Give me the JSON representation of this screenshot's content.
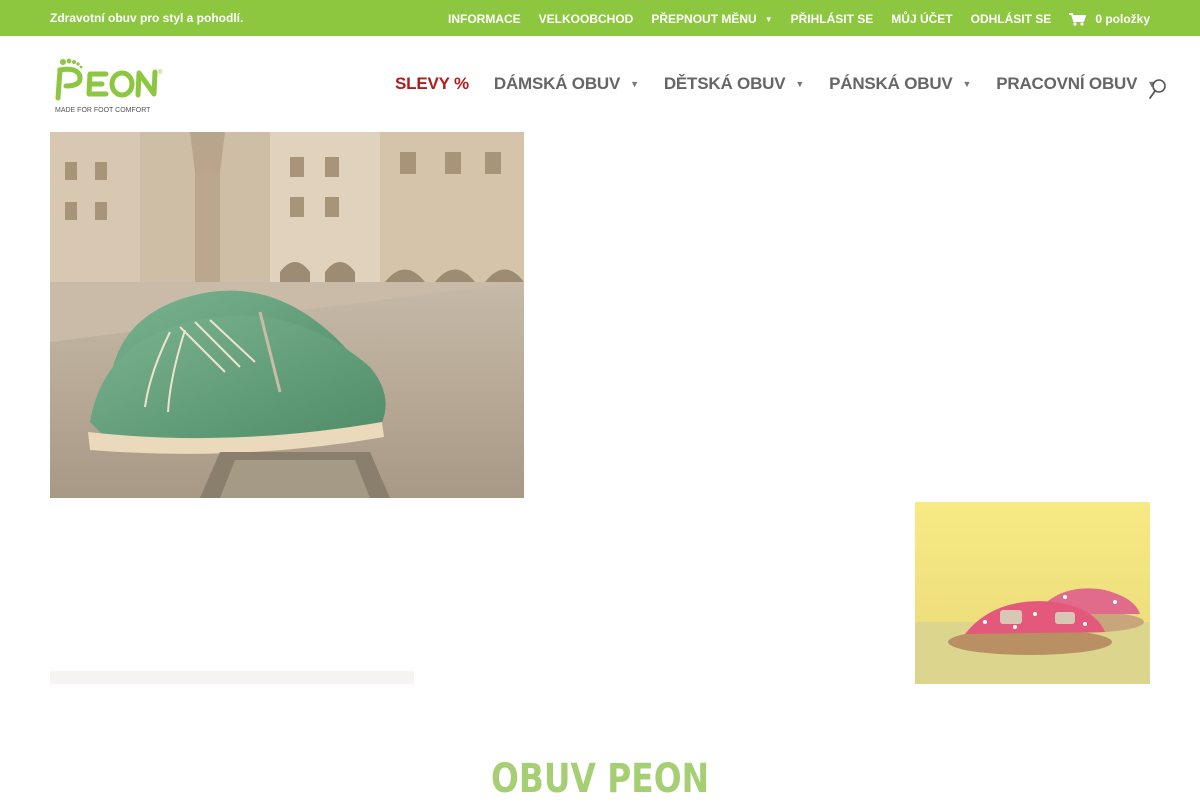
{
  "topbar": {
    "tagline": "Zdravotní obuv pro styl a pohodlí.",
    "links": [
      {
        "label": "INFORMACE"
      },
      {
        "label": "VELKOOBCHOD"
      },
      {
        "label": "PŘEPNOUT MĚNU"
      },
      {
        "label": "PŘIHLÁSIT SE"
      },
      {
        "label": "MŮJ ÚČET"
      },
      {
        "label": "ODHLÁSIT SE"
      }
    ],
    "cart": {
      "label": "0 položky",
      "icon": "cart-icon"
    },
    "color": "#8dc63f"
  },
  "logo": {
    "brand": "PEON",
    "tagline": "MADE FOR FOOT COMFORT"
  },
  "mainnav": {
    "items": [
      {
        "label": "SLEVY %"
      },
      {
        "label": "DÁMSKÁ OBUV"
      },
      {
        "label": "DĚTSKÁ OBUV"
      },
      {
        "label": "PÁNSKÁ OBUV"
      },
      {
        "label": "PRACOVNÍ OBUV"
      }
    ],
    "sale_color": "#b31b1b",
    "search_icon": "search-icon"
  },
  "content": {
    "hero_image": "green-shoes-town-square",
    "kids_image": "pink-sandals",
    "section_title": "OBUV PEON",
    "section_title_color": "#a6cf74"
  }
}
